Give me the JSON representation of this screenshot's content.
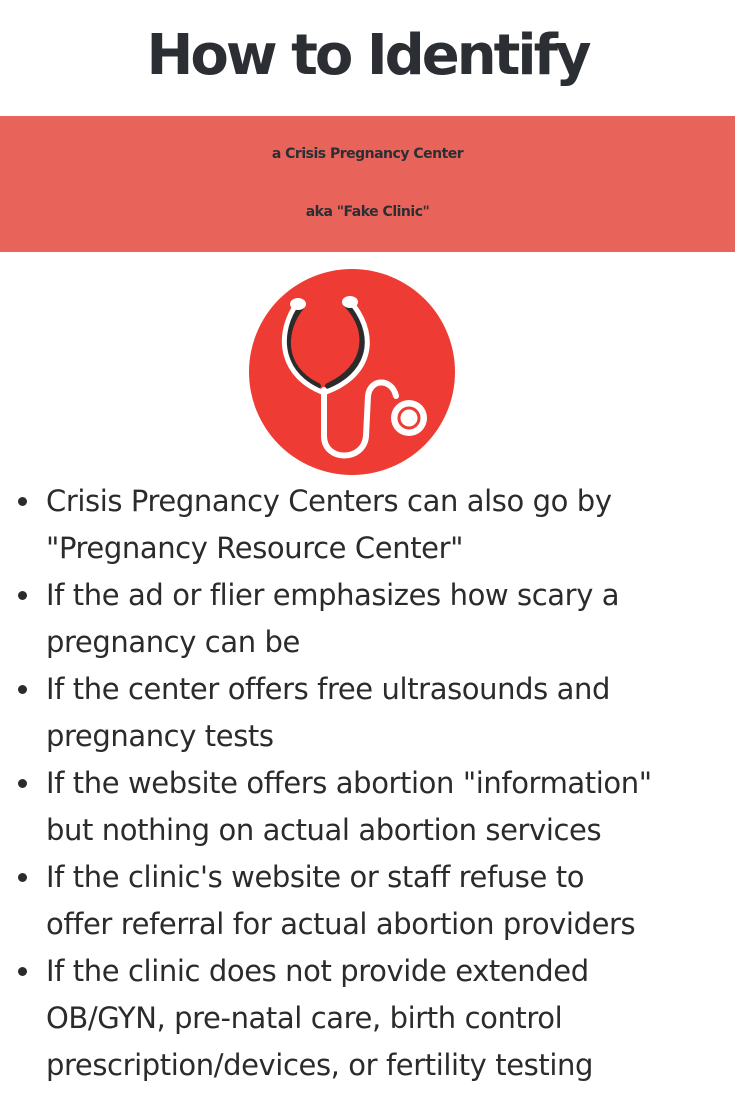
{
  "header": {
    "title": "How to Identify",
    "subtitle_line1": "a Crisis Pregnancy Center",
    "subtitle_line2": "aka \"Fake Clinic\""
  },
  "logo": {
    "icon": "stethoscope-icon",
    "circle_color": "#ee3b33",
    "banner_color": "#e8635a"
  },
  "bullets": [
    {
      "line1": "Crisis Pregnancy Centers can also go by",
      "line2": "\"Pregnancy Resource Center\""
    },
    {
      "line1": "If the ad or flier emphasizes how scary a",
      "line2": "pregnancy can be"
    },
    {
      "line1": "If the center offers free ultrasounds and",
      "line2": "pregnancy tests"
    },
    {
      "line1": "If the website offers abortion \"information\"",
      "line2": "but nothing on actual abortion services"
    },
    {
      "line1": "If the clinic's website or staff refuse to",
      "line2": "offer referral for actual abortion providers"
    },
    {
      "line1": "If the clinic does not provide extended",
      "line2": "OB/GYN, pre-natal care, birth control",
      "line3": "prescription/devices, or fertility testing"
    }
  ]
}
